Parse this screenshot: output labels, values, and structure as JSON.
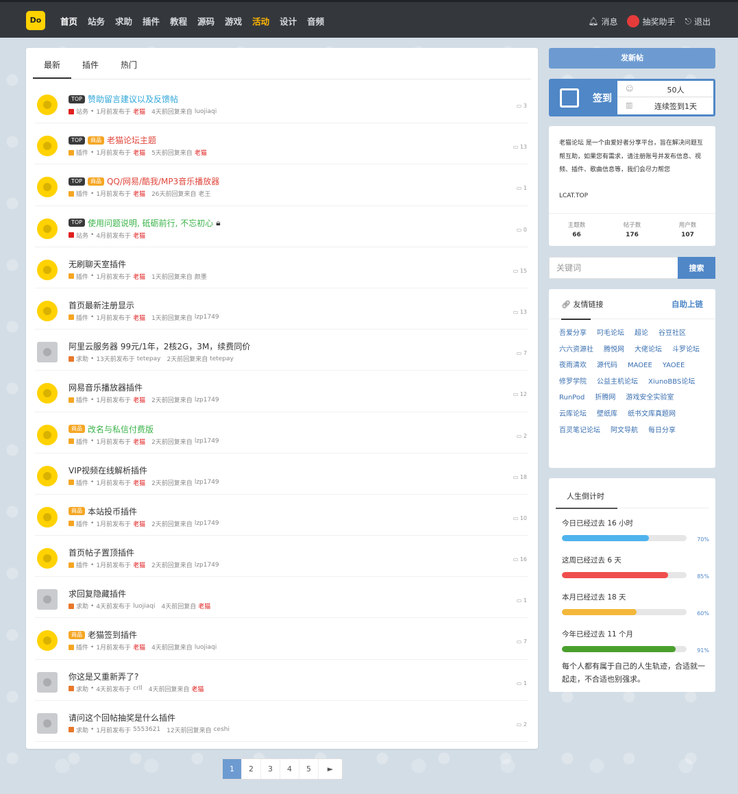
{
  "nav": {
    "logo": "Do",
    "items": [
      "首页",
      "站务",
      "求助",
      "插件",
      "教程",
      "源码",
      "游戏",
      "活动",
      "设计",
      "音频"
    ],
    "right": {
      "messages": "消息",
      "lottery": "抽奖助手",
      "logout": "退出"
    }
  },
  "tabs": [
    "最新",
    "插件",
    "热门"
  ],
  "threads": [
    {
      "badges": [
        "TOP"
      ],
      "title": "赞助留言建议以及反馈帖",
      "title_color": "blue",
      "category": "站务",
      "cat_color": "#e02020",
      "posted": "1月前发布于",
      "author": "老猫",
      "author_red": true,
      "reply": "4天前回复来自",
      "replier": "luojiaqi",
      "replier_red": false,
      "count": "3",
      "avatar": "yellow"
    },
    {
      "badges": [
        "TOP",
        "商品"
      ],
      "title": "老猫论坛主题",
      "title_color": "red",
      "category": "插件",
      "cat_color": "#f5a623",
      "posted": "1月前发布于",
      "author": "老猫",
      "author_red": true,
      "reply": "5天前回复来自",
      "replier": "老猫",
      "replier_red": true,
      "count": "13",
      "avatar": "yellow"
    },
    {
      "badges": [
        "TOP",
        "商品"
      ],
      "title": "QQ/网易/酷我/MP3音乐播放器",
      "title_color": "red",
      "category": "插件",
      "cat_color": "#f5a623",
      "posted": "1月前发布于",
      "author": "老猫",
      "author_red": true,
      "reply": "26天前回复来自",
      "replier": "老王",
      "replier_red": false,
      "count": "1",
      "avatar": "yellow"
    },
    {
      "badges": [
        "TOP"
      ],
      "title": "使用问题说明, 砥砺前行, 不忘初心",
      "title_color": "green",
      "lock": true,
      "category": "站务",
      "cat_color": "#e02020",
      "posted": "4月前发布于",
      "author": "老猫",
      "author_red": true,
      "reply": "",
      "replier": "",
      "replier_red": false,
      "count": "0",
      "avatar": "yellow"
    },
    {
      "badges": [],
      "title": "无刷聊天室插件",
      "title_color": "",
      "category": "插件",
      "cat_color": "#f5a623",
      "posted": "1月前发布于",
      "author": "老猫",
      "author_red": true,
      "reply": "1天前回复来自",
      "replier": "颜墨",
      "replier_red": false,
      "count": "15",
      "avatar": "yellow"
    },
    {
      "badges": [],
      "title": "首页最新注册显示",
      "title_color": "",
      "category": "插件",
      "cat_color": "#f5a623",
      "posted": "1月前发布于",
      "author": "老猫",
      "author_red": true,
      "reply": "1天前回复来自",
      "replier": "lzp1749",
      "replier_red": false,
      "count": "13",
      "avatar": "yellow"
    },
    {
      "badges": [],
      "title": "阿里云服务器 99元/1年，2核2G，3M，续费同价",
      "title_color": "",
      "category": "求助",
      "cat_color": "#e8782a",
      "posted": "13天前发布于",
      "author": "tetepay",
      "author_red": false,
      "reply": "2天前回复来自",
      "replier": "tetepay",
      "replier_red": false,
      "count": "7",
      "avatar": "gray"
    },
    {
      "badges": [],
      "title": "网易音乐播放器插件",
      "title_color": "",
      "category": "插件",
      "cat_color": "#f5a623",
      "posted": "1月前发布于",
      "author": "老猫",
      "author_red": true,
      "reply": "2天前回复来自",
      "replier": "lzp1749",
      "replier_red": false,
      "count": "12",
      "avatar": "yellow"
    },
    {
      "badges": [
        "商品"
      ],
      "title": "改名与私信付费版",
      "title_color": "green",
      "category": "插件",
      "cat_color": "#f5a623",
      "posted": "1月前发布于",
      "author": "老猫",
      "author_red": true,
      "reply": "2天前回复来自",
      "replier": "lzp1749",
      "replier_red": false,
      "count": "2",
      "avatar": "yellow"
    },
    {
      "badges": [],
      "title": "VIP视频在线解析插件",
      "title_color": "",
      "category": "插件",
      "cat_color": "#f5a623",
      "posted": "1月前发布于",
      "author": "老猫",
      "author_red": true,
      "reply": "2天前回复来自",
      "replier": "lzp1749",
      "replier_red": false,
      "count": "18",
      "avatar": "yellow"
    },
    {
      "badges": [
        "商品"
      ],
      "title": "本站投币插件",
      "title_color": "",
      "category": "插件",
      "cat_color": "#f5a623",
      "posted": "1月前发布于",
      "author": "老猫",
      "author_red": true,
      "reply": "2天前回复来自",
      "replier": "lzp1749",
      "replier_red": false,
      "count": "10",
      "avatar": "yellow"
    },
    {
      "badges": [],
      "title": "首页帖子置顶插件",
      "title_color": "",
      "category": "插件",
      "cat_color": "#f5a623",
      "posted": "1月前发布于",
      "author": "老猫",
      "author_red": true,
      "reply": "2天前回复来自",
      "replier": "lzp1749",
      "replier_red": false,
      "count": "16",
      "avatar": "yellow"
    },
    {
      "badges": [],
      "title": "求回复隐藏插件",
      "title_color": "",
      "category": "求助",
      "cat_color": "#e8782a",
      "posted": "4天前发布于",
      "author": "luojiaqi",
      "author_red": false,
      "reply": "4天前回复自",
      "replier": "老猫",
      "replier_red": true,
      "count": "1",
      "avatar": "gray"
    },
    {
      "badges": [
        "商品"
      ],
      "title": "老猫签到插件",
      "title_color": "",
      "category": "插件",
      "cat_color": "#f5a623",
      "posted": "1月前发布于",
      "author": "老猫",
      "author_red": true,
      "reply": "4天前回复来自",
      "replier": "luojiaqi",
      "replier_red": false,
      "count": "7",
      "avatar": "yellow"
    },
    {
      "badges": [],
      "title": "你这是又重新弄了?",
      "title_color": "",
      "category": "求助",
      "cat_color": "#e8782a",
      "posted": "4天前发布于",
      "author": "crll",
      "author_red": false,
      "reply": "4天前回复来自",
      "replier": "老猫",
      "replier_red": true,
      "count": "1",
      "avatar": "gray"
    },
    {
      "badges": [],
      "title": "请问这个回帖抽奖是什么插件",
      "title_color": "",
      "category": "求助",
      "cat_color": "#e8782a",
      "posted": "1月前发布于",
      "author": "5553621",
      "author_red": false,
      "reply": "12天前回复来自",
      "replier": "ceshi",
      "replier_red": false,
      "count": "2",
      "avatar": "gray"
    }
  ],
  "pager": [
    "1",
    "2",
    "3",
    "4",
    "5",
    "►"
  ],
  "sidebar": {
    "new_post": "发新帖",
    "sign": {
      "label": "签到",
      "people": "50人",
      "streak": "连续签到1天"
    },
    "about": {
      "desc": "老猫论坛 是一个由爱好者分享平台，旨在解决问题互帮互助，如果您有需求，请注册账号并发布信息、视频、插件、歌曲信息等，我们会尽力帮您",
      "site": "LCAT.TOP",
      "stats": [
        {
          "label": "主题数",
          "value": "66"
        },
        {
          "label": "帖子数",
          "value": "176"
        },
        {
          "label": "用户数",
          "value": "107"
        }
      ]
    },
    "search": {
      "placeholder": "关键词",
      "button": "搜索"
    },
    "links": {
      "title": "友情链接",
      "self": "自助上链",
      "items": [
        "吾爱分享",
        "叼毛论坛",
        "超论",
        "谷豆社区",
        "六六资源社",
        "腾悦网",
        "大佬论坛",
        "斗罗论坛",
        "夜雨清欢",
        "源代码",
        "MAOEE",
        "YAOEE",
        "修罗学院",
        "公益主机论坛",
        "XiunoBBS论坛",
        "RunPod",
        "折腾网",
        "游戏安全实验室",
        "云库论坛",
        "壁纸库",
        "纸书文库真题网",
        "百灵笔记论坛",
        "阿文导航",
        "每日分享"
      ]
    },
    "life": {
      "title": "人生倒计时",
      "bars": [
        {
          "label": "今日已经过去 16 小时",
          "pct": "70%",
          "value": 0.7,
          "color": "#4fb3ee"
        },
        {
          "label": "这周已经过去 6 天",
          "pct": "85%",
          "value": 0.85,
          "color": "#f04e4e"
        },
        {
          "label": "本月已经过去 18 天",
          "pct": "60%",
          "value": 0.6,
          "color": "#f3b73a"
        },
        {
          "label": "今年已经过去 11 个月",
          "pct": "91%",
          "value": 0.91,
          "color": "#4aa02c"
        }
      ],
      "quote": "每个人都有属于自己的人生轨迹，合适就一起走，不合适也别强求。"
    }
  }
}
